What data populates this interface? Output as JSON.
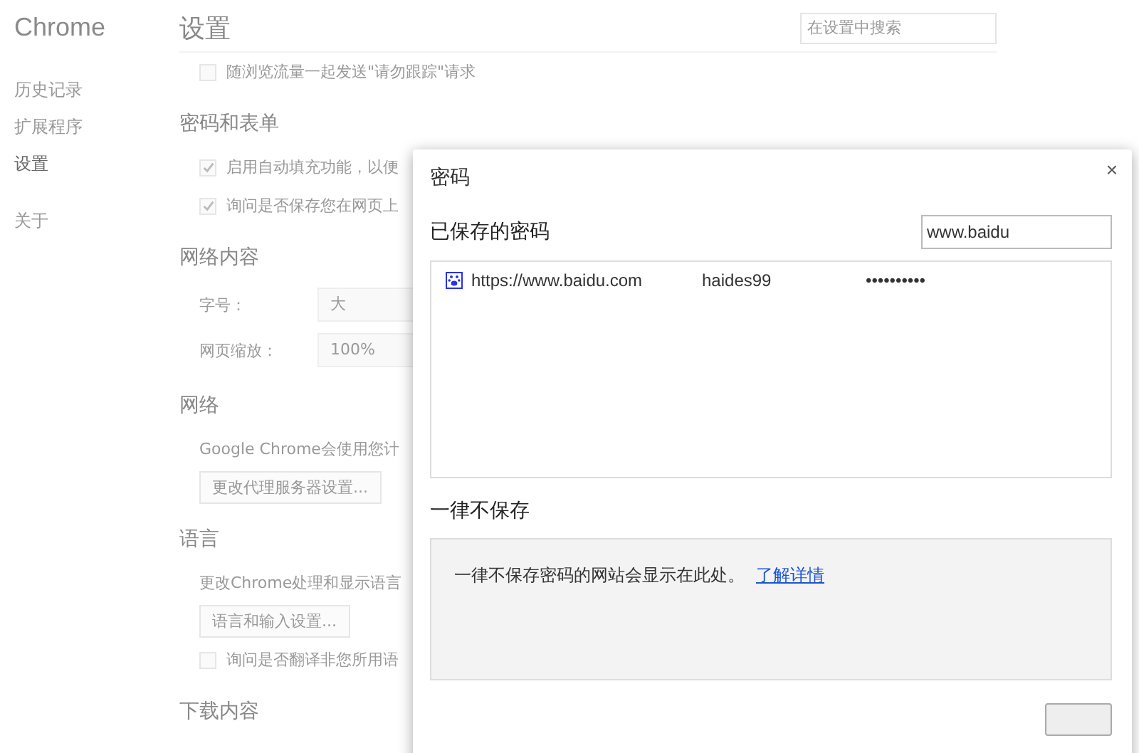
{
  "sidebar": {
    "title": "Chrome",
    "items": [
      {
        "label": "历史记录",
        "selected": false
      },
      {
        "label": "扩展程序",
        "selected": false
      },
      {
        "label": "设置",
        "selected": true
      },
      {
        "label": "关于",
        "selected": false
      }
    ]
  },
  "settings": {
    "title": "设置",
    "search": {
      "placeholder": "在设置中搜索"
    },
    "sections": [
      {
        "kind": "plain",
        "items": [
          {
            "kind": "checkbox",
            "label": "随浏览流量一起发送\"请勿跟踪\"请求",
            "checked": false
          }
        ]
      },
      {
        "kind": "section",
        "title": "密码和表单",
        "items": [
          {
            "kind": "checkbox",
            "label": "启用自动填充功能，以便",
            "checked": true
          },
          {
            "kind": "checkbox",
            "label": "询问是否保存您在网页上",
            "checked": true
          }
        ]
      },
      {
        "kind": "section",
        "title": "网络内容",
        "items": [
          {
            "kind": "select",
            "label": "字号：",
            "value": "大"
          },
          {
            "kind": "select",
            "label": "网页缩放：",
            "value": "100%"
          }
        ]
      },
      {
        "kind": "section",
        "title": "网络",
        "items": [
          {
            "kind": "text",
            "label": "Google Chrome会使用您计"
          },
          {
            "kind": "button",
            "label": "更改代理服务器设置..."
          }
        ]
      },
      {
        "kind": "section",
        "title": "语言",
        "items": [
          {
            "kind": "text",
            "label": "更改Chrome处理和显示语言"
          },
          {
            "kind": "button",
            "label": "语言和输入设置..."
          },
          {
            "kind": "checkbox",
            "label": "询问是否翻译非您所用语",
            "checked": false
          }
        ]
      },
      {
        "kind": "section",
        "title": "下载内容"
      }
    ]
  },
  "dialog": {
    "title": "密码",
    "close": "×",
    "saved_title": "已保存的密码",
    "search_value": "www.baidu",
    "passwords": [
      {
        "site": "https://www.baidu.com",
        "username": "haides99",
        "password": "••••••••••"
      }
    ],
    "never_title": "一律不保存",
    "never_text": "一律不保存密码的网站会显示在此处。",
    "never_link": "了解详情"
  }
}
